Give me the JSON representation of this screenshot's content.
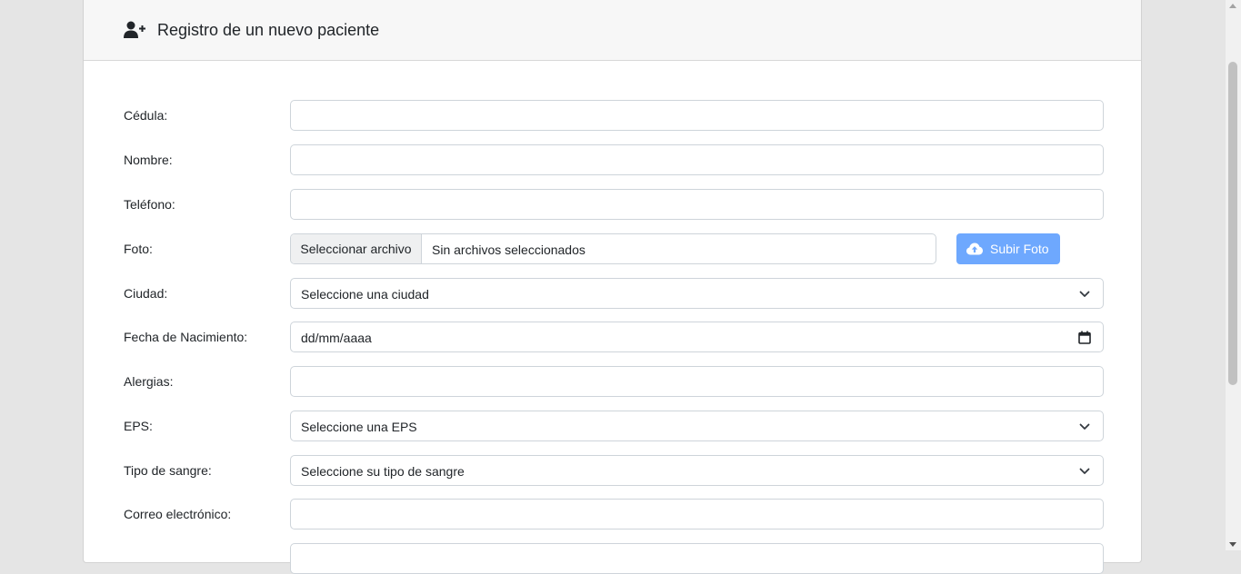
{
  "header": {
    "icon": "user-plus-icon",
    "title": "Registro de un nuevo paciente"
  },
  "form": {
    "cedula": {
      "label": "Cédula:",
      "value": ""
    },
    "nombre": {
      "label": "Nombre:",
      "value": ""
    },
    "telefono": {
      "label": "Teléfono:",
      "value": ""
    },
    "foto": {
      "label": "Foto:",
      "choose_label": "Seleccionar archivo",
      "status": "Sin archivos seleccionados",
      "upload_label": "Subir Foto",
      "upload_icon": "cloud-upload-icon"
    },
    "ciudad": {
      "label": "Ciudad:",
      "selected": "Seleccione una ciudad"
    },
    "fecha": {
      "label": "Fecha de Nacimiento:",
      "placeholder": "dd/mm/aaaa",
      "icon": "calendar-icon"
    },
    "alergias": {
      "label": "Alergias:",
      "value": ""
    },
    "eps": {
      "label": "EPS:",
      "selected": "Seleccione una EPS"
    },
    "sangre": {
      "label": "Tipo de sangre:",
      "selected": "Seleccione su tipo de sangre"
    },
    "correo": {
      "label": "Correo electrónico:",
      "value": ""
    }
  },
  "colors": {
    "page_bg": "#e5e5e5",
    "header_bg": "#f7f7f7",
    "upload_button": "#6ea8fe",
    "input_border": "#ced4da"
  }
}
